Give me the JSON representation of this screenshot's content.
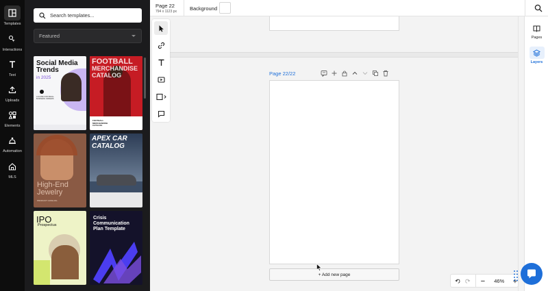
{
  "sidebar": {
    "items": [
      {
        "label": "Templates",
        "icon": "templates-icon"
      },
      {
        "label": "Interactions",
        "icon": "interactions-icon"
      },
      {
        "label": "Text",
        "icon": "text-icon"
      },
      {
        "label": "Uploads",
        "icon": "upload-icon"
      },
      {
        "label": "Elements",
        "icon": "elements-icon"
      },
      {
        "label": "Automation",
        "icon": "automation-icon"
      },
      {
        "label": "MLS",
        "icon": "home-icon"
      }
    ]
  },
  "templates_panel": {
    "search_placeholder": "Search templates...",
    "filter_value": "Featured",
    "cards": [
      {
        "line1": "Social Media",
        "line2": "Trends",
        "line3": "in 2025",
        "body": "A GUIDE FOR SMALL BUSINESS OWNERS"
      },
      {
        "line1": "FOOTBALL",
        "line2": "MERCHANDISE",
        "line3": "CATALOG",
        "body": "FOOTBALL MERCHANDISE CATALOG"
      },
      {
        "line1": "High-End",
        "line2": "Jewelry",
        "line3": "",
        "body": "PRODUCT CATALOG"
      },
      {
        "line1": "APEX CAR",
        "line2": "CATALOG",
        "line3": "",
        "body": ""
      },
      {
        "line1": "IPO",
        "line2": "Prospectus",
        "line3": "",
        "body": ""
      },
      {
        "line1": "Crisis",
        "line2": "Communication",
        "line3": "Plan Template",
        "body": ""
      }
    ]
  },
  "topbar": {
    "page_title": "Page 22",
    "page_dims": "794 x 1123 px",
    "background_label": "Background"
  },
  "canvas": {
    "page_label": "Page 22/22",
    "add_page_label": "+ Add new page"
  },
  "right_panel": {
    "pages_label": "Pages",
    "layers_label": "Layers"
  },
  "zoom": {
    "value": "46%"
  },
  "colors": {
    "accent": "#1e6fd9",
    "rail_bg": "#0d0d0d",
    "panel_bg": "#1b1b1d"
  }
}
